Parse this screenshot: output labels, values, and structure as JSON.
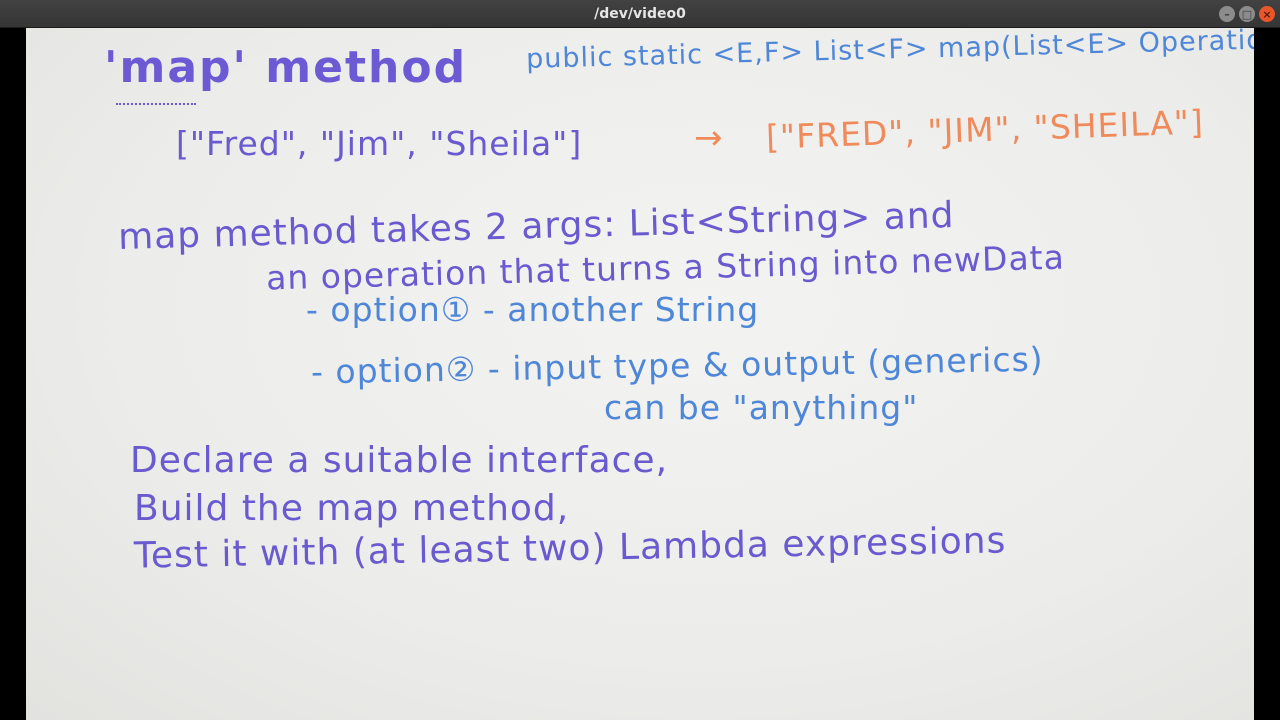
{
  "window": {
    "title": "/dev/video0",
    "controls": {
      "minimize": "–",
      "maximize": "□",
      "close": "×"
    }
  },
  "board": {
    "heading": "'map' method",
    "signature": "public static <E,F> List<F> map(List<E> Operation",
    "example": {
      "input": "[\"Fred\", \"Jim\", \"Sheila\"]",
      "arrow": "→",
      "output": "[\"FRED\", \"JIM\", \"SHEILA\"]"
    },
    "lines": [
      "map method takes 2 args: List<String> and",
      "an operation that turns a String into newData",
      "- option① - another String",
      "- option② - input type & output (generics)",
      "can be \"anything\"",
      "Declare a suitable interface,",
      "Build the map method,",
      "Test it with (at least two) Lambda expressions"
    ]
  }
}
